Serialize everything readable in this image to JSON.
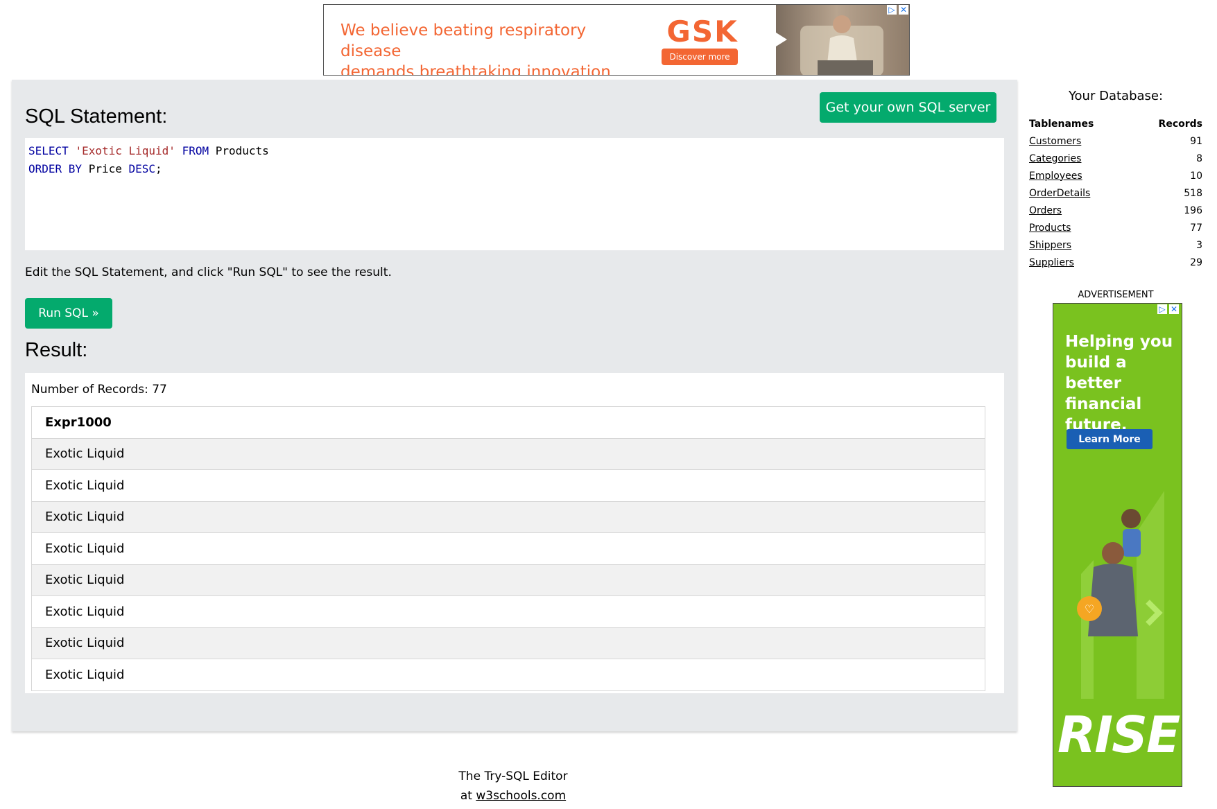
{
  "top_ad": {
    "line1": "We believe beating respiratory disease",
    "line2": "demands breathtaking innovation",
    "logo": "GSK",
    "cta": "Discover more",
    "adchoices_icon": "adchoices-icon",
    "close_icon": "close-icon"
  },
  "editor": {
    "heading": "SQL Statement:",
    "get_server_label": "Get your own SQL server",
    "code": {
      "l1_kw1": "SELECT",
      "l1_str": "'Exotic Liquid'",
      "l1_kw2": "FROM",
      "l1_ident": "Products",
      "l2_kw1": "ORDER BY",
      "l2_ident": "Price",
      "l2_kw2": "DESC",
      "l2_end": ";"
    },
    "hint": "Edit the SQL Statement, and click \"Run SQL\" to see the result.",
    "run_label": "Run SQL »"
  },
  "result": {
    "heading": "Result:",
    "record_count": "Number of Records: 77",
    "column": "Expr1000",
    "rows": [
      "Exotic Liquid",
      "Exotic Liquid",
      "Exotic Liquid",
      "Exotic Liquid",
      "Exotic Liquid",
      "Exotic Liquid",
      "Exotic Liquid",
      "Exotic Liquid"
    ]
  },
  "database": {
    "title": "Your Database:",
    "col_names": "Tablenames",
    "col_records": "Records",
    "tables": [
      {
        "name": "Customers",
        "records": "91"
      },
      {
        "name": "Categories",
        "records": "8"
      },
      {
        "name": "Employees",
        "records": "10"
      },
      {
        "name": "OrderDetails",
        "records": "518"
      },
      {
        "name": "Orders",
        "records": "196"
      },
      {
        "name": "Products",
        "records": "77"
      },
      {
        "name": "Shippers",
        "records": "3"
      },
      {
        "name": "Suppliers",
        "records": "29"
      }
    ]
  },
  "side_ad": {
    "label": "ADVERTISEMENT",
    "headline": "Helping you build a better financial future.",
    "cta": "Learn More",
    "brand": "RISE"
  },
  "footer": {
    "line1": "The Try-SQL Editor",
    "at": "at",
    "link": "w3schools.com"
  },
  "colors": {
    "accent_green": "#04aa6d",
    "panel_gray": "#e7e9eb",
    "gsk_orange": "#f36633",
    "rise_green": "#7ac21f"
  }
}
